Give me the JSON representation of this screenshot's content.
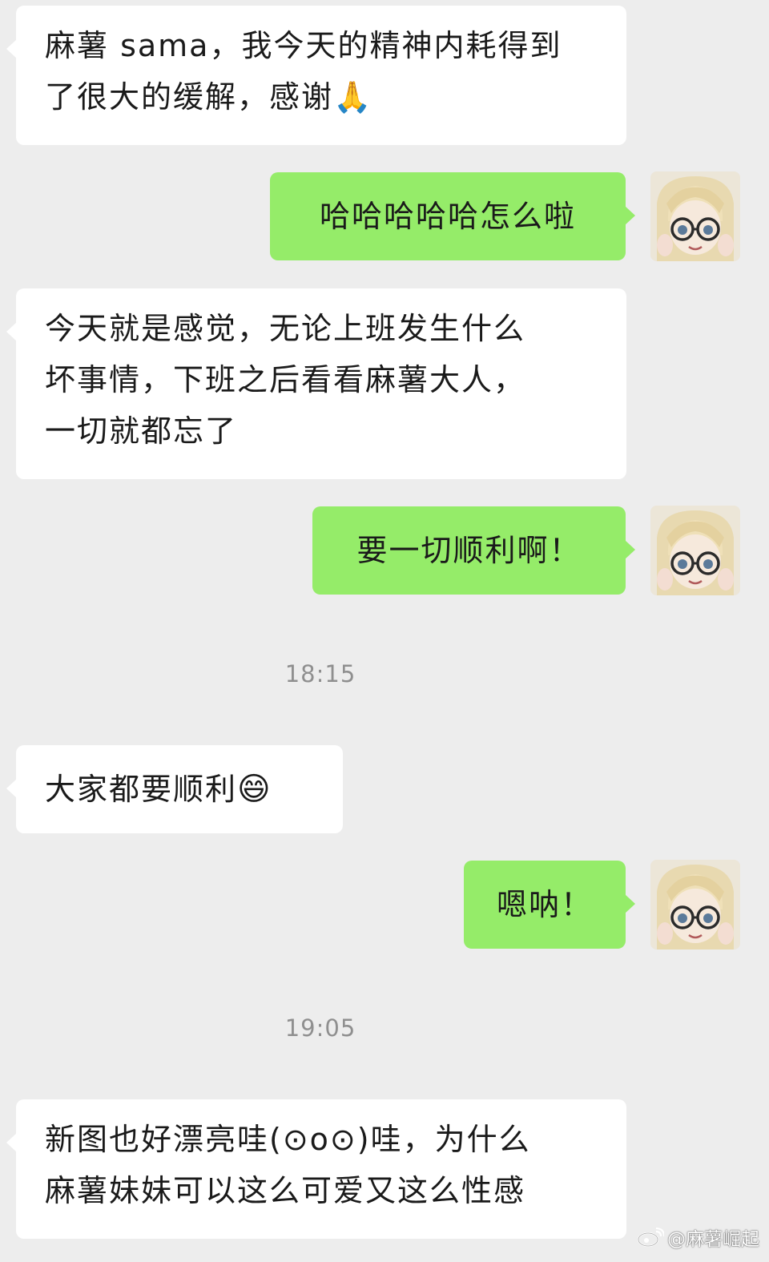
{
  "messages": [
    {
      "side": "in",
      "lines": [
        "麻薯 sama，我今天的精神内耗得到",
        "了很大的缓解，感谢🙏"
      ]
    },
    {
      "side": "out",
      "text": "哈哈哈哈哈怎么啦"
    },
    {
      "side": "in",
      "lines": [
        "今天就是感觉，无论上班发生什么",
        "坏事情，下班之后看看麻薯大人，",
        "一切就都忘了"
      ]
    },
    {
      "side": "out",
      "text": "要一切顺利啊！"
    },
    {
      "side": "time",
      "text": "18:15"
    },
    {
      "side": "in",
      "text": "大家都要顺利",
      "emoji": "😄"
    },
    {
      "side": "out",
      "text": "嗯呐！"
    },
    {
      "side": "time",
      "text": "19:05"
    },
    {
      "side": "in",
      "lines": [
        "新图也好漂亮哇(⊙o⊙)哇，为什么",
        "麻薯妹妹可以这么可爱又这么性感"
      ]
    }
  ],
  "watermark": {
    "text": "@麻薯崛起",
    "icon": "weibo-icon"
  },
  "colors": {
    "background": "#ededed",
    "incoming_bubble": "#ffffff",
    "outgoing_bubble": "#95ec69",
    "timestamp_text": "#8f8f8f"
  }
}
